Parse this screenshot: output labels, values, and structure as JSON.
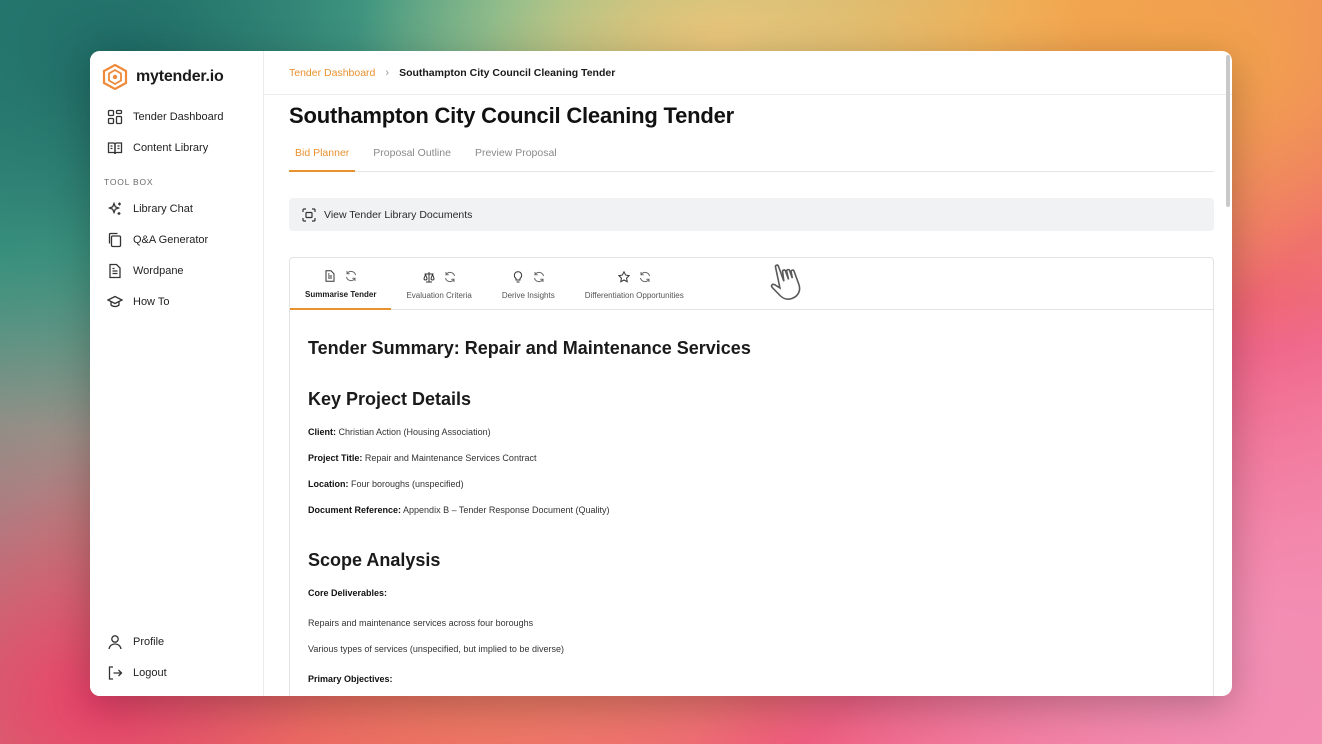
{
  "brand": {
    "name": "mytender.io"
  },
  "sidebar": {
    "items": [
      {
        "label": "Tender Dashboard",
        "icon": "grid-icon"
      },
      {
        "label": "Content Library",
        "icon": "book-icon"
      }
    ],
    "section_label": "TOOL BOX",
    "tools": [
      {
        "label": "Library Chat",
        "icon": "sparkle-icon"
      },
      {
        "label": "Q&A Generator",
        "icon": "copy-icon"
      },
      {
        "label": "Wordpane",
        "icon": "document-icon"
      },
      {
        "label": "How To",
        "icon": "graduation-cap-icon"
      }
    ],
    "bottom": [
      {
        "label": "Profile",
        "icon": "user-icon"
      },
      {
        "label": "Logout",
        "icon": "logout-icon"
      }
    ]
  },
  "breadcrumb": {
    "parent": "Tender Dashboard",
    "current": "Southampton City Council Cleaning Tender"
  },
  "page_title": "Southampton City Council Cleaning Tender",
  "tabs": [
    {
      "label": "Bid Planner",
      "active": true
    },
    {
      "label": "Proposal Outline",
      "active": false
    },
    {
      "label": "Preview Proposal",
      "active": false
    }
  ],
  "library_bar": {
    "label": "View Tender Library Documents"
  },
  "tool_tabs": [
    {
      "label": "Summarise Tender",
      "icon": "file-text-icon",
      "active": true
    },
    {
      "label": "Evaluation Criteria",
      "icon": "scale-icon",
      "active": false
    },
    {
      "label": "Derive Insights",
      "icon": "lightbulb-icon",
      "active": false
    },
    {
      "label": "Differentiation Opportunities",
      "icon": "star-icon",
      "active": false
    }
  ],
  "document": {
    "title": "Tender Summary: Repair and Maintenance Services",
    "section1": "Key Project Details",
    "details": [
      {
        "key": "Client:",
        "value": " Christian Action (Housing Association)"
      },
      {
        "key": "Project Title:",
        "value": " Repair and Maintenance Services Contract"
      },
      {
        "key": "Location:",
        "value": " Four boroughs (unspecified)"
      },
      {
        "key": "Document Reference:",
        "value": " Appendix B – Tender Response Document (Quality)"
      }
    ],
    "section2": "Scope Analysis",
    "core_label": "Core Deliverables:",
    "core_items": [
      "Repairs and maintenance services across four boroughs",
      "Various types of services (unspecified, but implied to be diverse)"
    ],
    "primary_label": "Primary Objectives:"
  },
  "colors": {
    "accent": "#e8912f"
  }
}
